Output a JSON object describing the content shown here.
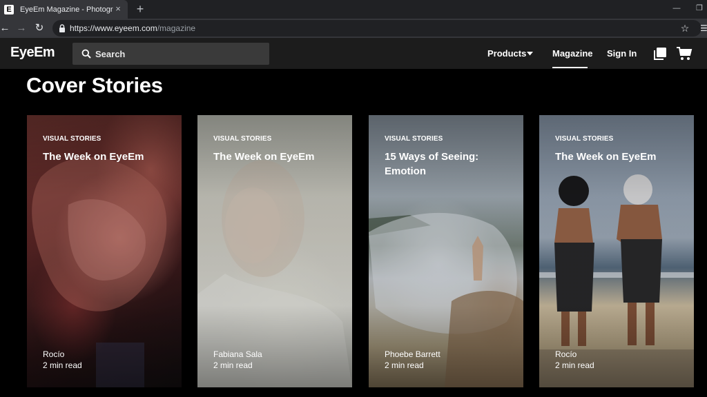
{
  "browser": {
    "tab_icon_letter": "E",
    "tab_title": "EyeEm Magazine - Photography",
    "tab_close": "×",
    "new_tab": "+",
    "minimize": "—",
    "restore": "❐",
    "url_host": "https://www.eyeem.com",
    "url_path": "/magazine"
  },
  "header": {
    "logo": "EyeEm",
    "search_placeholder": "Search",
    "nav": {
      "products": "Products",
      "magazine": "Magazine",
      "signin": "Sign In"
    }
  },
  "page": {
    "title": "Cover Stories"
  },
  "cards": [
    {
      "category": "VISUAL STORIES",
      "title": "The Week on EyeEm",
      "author": "Rocío",
      "read_time": "2 min read"
    },
    {
      "category": "VISUAL STORIES",
      "title": "The Week on EyeEm",
      "author": "Fabiana Sala",
      "read_time": "2 min read"
    },
    {
      "category": "VISUAL STORIES",
      "title": "15 Ways of Seeing: Emotion",
      "author": "Phoebe Barrett",
      "read_time": "2 min read"
    },
    {
      "category": "VISUAL STORIES",
      "title": "The Week on EyeEm",
      "author": "Rocío",
      "read_time": "2 min read"
    }
  ],
  "icons": {
    "back": "back-arrow-icon",
    "forward": "forward-arrow-icon",
    "reload": "reload-icon",
    "lock": "lock-icon",
    "bookmark": "star-icon",
    "search": "search-icon",
    "caret": "chevron-down-icon",
    "gallery": "gallery-icon",
    "cart": "cart-icon"
  },
  "colors": {
    "background": "#000000",
    "header_bg": "#1c1c1c",
    "search_bg": "#3a3a3a",
    "chrome_tab": "#35363a",
    "chrome_bar": "#202124"
  }
}
